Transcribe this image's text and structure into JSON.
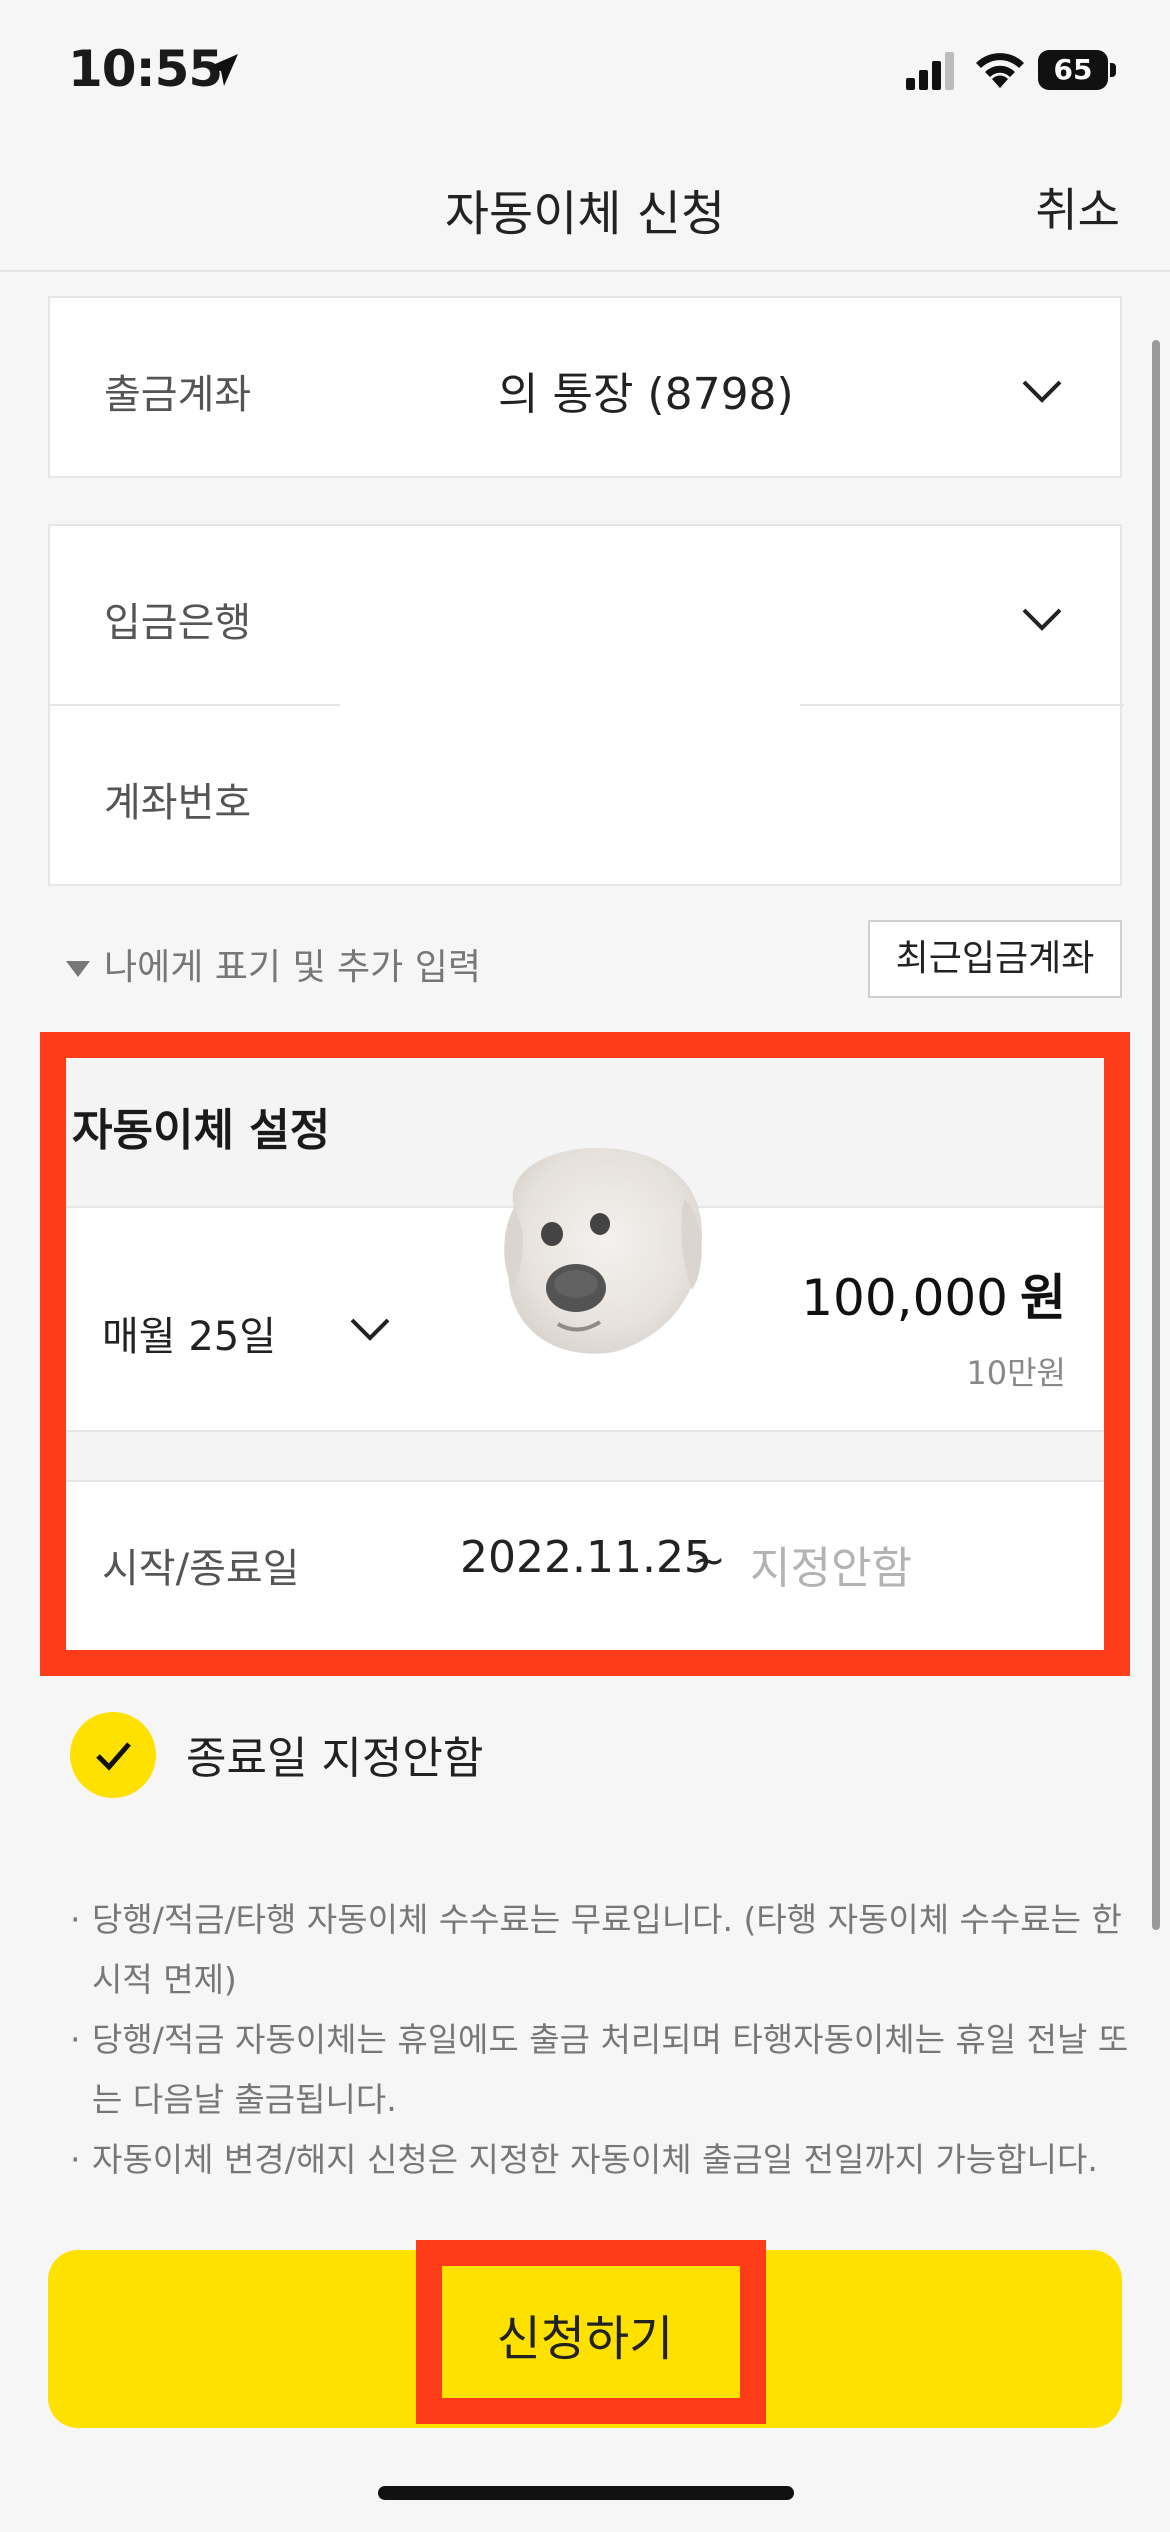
{
  "status_bar": {
    "time": "10:55",
    "battery": "65"
  },
  "nav": {
    "title": "자동이체 신청",
    "cancel": "취소"
  },
  "withdraw": {
    "label": "출금계좌",
    "account": "의 통장 (8798)"
  },
  "deposit": {
    "bank_label": "입금은행",
    "account_label": "계좌번호"
  },
  "extra": {
    "more_input": "나에게 표기 및 추가 입력",
    "recent_button": "최근입금계좌"
  },
  "auto_transfer": {
    "title": "자동이체 설정",
    "day": "매월 25일",
    "amount": "100,000",
    "amount_unit": "원",
    "amount_korean": "10만원",
    "date_label": "시작/종료일",
    "start_date": "2022.11.25",
    "tilde": "~",
    "end_date": "지정안함"
  },
  "end_date_option": {
    "label": "종료일 지정안함",
    "checked": true
  },
  "notices": [
    "당행/적금/타행 자동이체 수수료는 무료입니다. (타행 자동이체 수수료는 한시적 면제)",
    "당행/적금 자동이체는 휴일에도 출금 처리되며 타행자동이체는 휴일 전날 또는 다음날 출금됩니다.",
    "자동이체 변경/해지 신청은 지정한 자동이체 출금일 전일까지 가능합니다."
  ],
  "submit": {
    "label": "신청하기"
  },
  "colors": {
    "accent_yellow": "#ffe100",
    "highlight_red": "#ff3c1a"
  },
  "icons": [
    "location-arrow-icon",
    "signal-icon",
    "wifi-icon",
    "battery-icon",
    "chevron-down-icon",
    "check-icon",
    "triangle-down-icon"
  ]
}
